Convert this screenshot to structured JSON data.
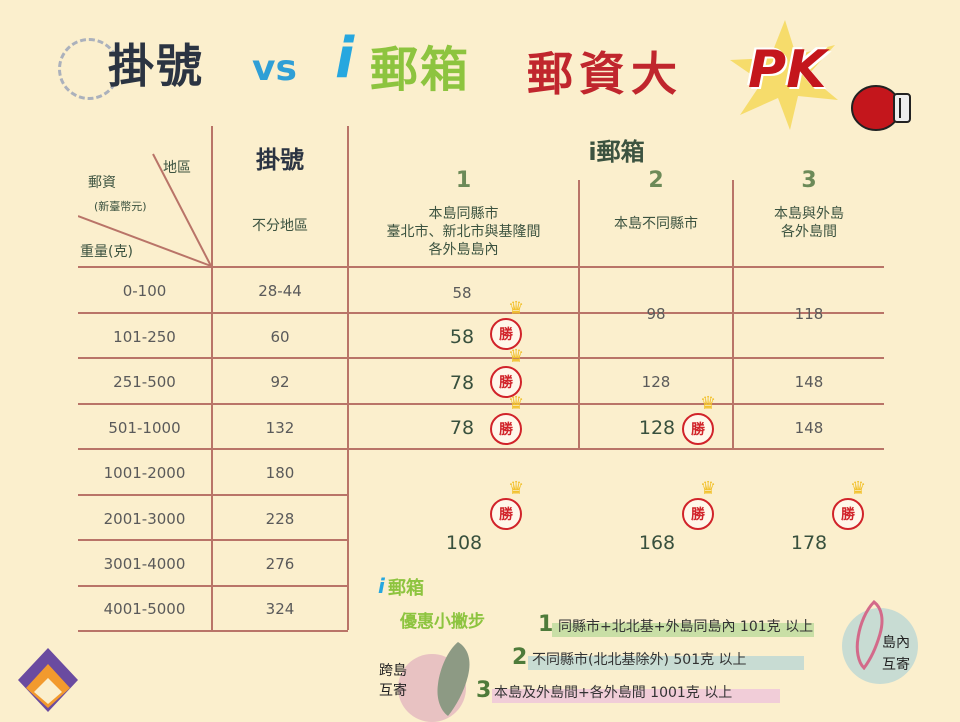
{
  "title": {
    "registered": "掛號",
    "vs": "vs",
    "ibox_i": "i",
    "ibox_text": "郵箱",
    "rate": "郵資大",
    "pk": "PK"
  },
  "header": {
    "axis_region": "地區",
    "axis_rate": "郵資",
    "axis_currency": "(新臺幣元)",
    "axis_weight": "重量(克)",
    "col_registered": "掛號",
    "col_registered_sub": "不分地區",
    "col_ibox": "i郵箱",
    "zone1_num": "1",
    "zone1_l1": "本島同縣市",
    "zone1_l2": "臺北市、新北市與基隆間",
    "zone1_l3": "各外島島內",
    "zone2_num": "2",
    "zone2_l1": "本島不同縣市",
    "zone3_num": "3",
    "zone3_l1": "本島與外島",
    "zone3_l2": "各外島間"
  },
  "rows": [
    {
      "weight": "0-100",
      "registered": "28-44"
    },
    {
      "weight": "101-250",
      "registered": "60"
    },
    {
      "weight": "251-500",
      "registered": "92"
    },
    {
      "weight": "501-1000",
      "registered": "132"
    },
    {
      "weight": "1001-2000",
      "registered": "180"
    },
    {
      "weight": "2001-3000",
      "registered": "228"
    },
    {
      "weight": "3001-4000",
      "registered": "276"
    },
    {
      "weight": "4001-5000",
      "registered": "324"
    }
  ],
  "zone1": {
    "r1": "58",
    "r2": "58",
    "r3": "78",
    "r4": "78",
    "r5": "108"
  },
  "zone2": {
    "r12": "98",
    "r3": "128",
    "r4": "128",
    "r5": "168"
  },
  "zone3": {
    "r12": "118",
    "r3": "148",
    "r4": "148",
    "r5": "178"
  },
  "win_label": "勝",
  "tips": {
    "brand_i": "i",
    "brand_text": "郵箱",
    "heading": "優惠小撇步",
    "t1_num": "1",
    "t1": "同縣市+北北基+外島同島內 101克 以上",
    "t2_num": "2",
    "t2": "不同縣市(北北基除外) 501克 以上",
    "t3_num": "3",
    "t3": "本島及外島間+各外島間 1001克 以上",
    "left_l1": "跨島",
    "left_l2": "互寄",
    "right_l1": "島內",
    "right_l2": "互寄"
  },
  "colors": {
    "accent_red": "#c4161c",
    "accent_green": "#8dc43f",
    "accent_blue": "#26a7df",
    "line": "#b97468",
    "background": "#fbefcd"
  }
}
